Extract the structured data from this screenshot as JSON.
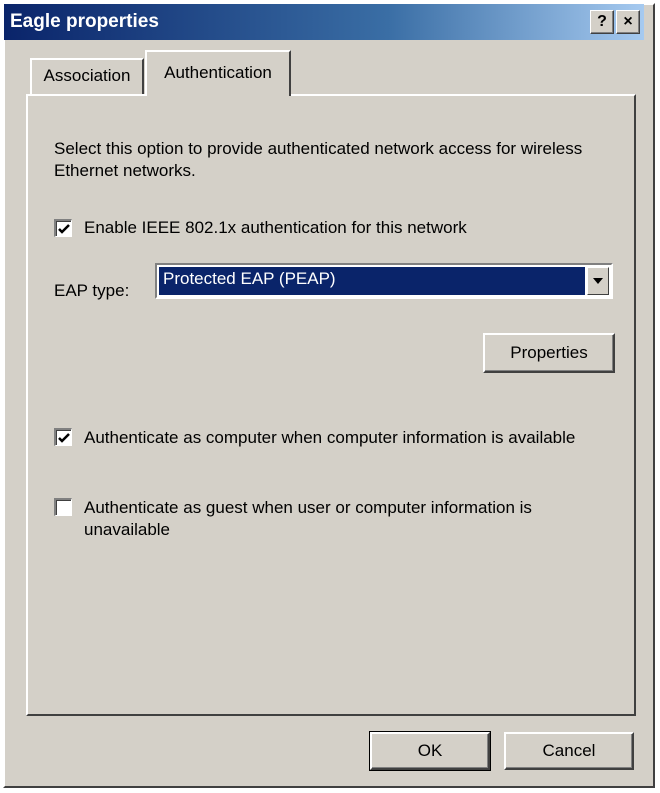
{
  "window": {
    "title": "Eagle properties",
    "help_button": "?",
    "close_button": "×"
  },
  "tabs": [
    {
      "label": "Association",
      "selected": false
    },
    {
      "label": "Authentication",
      "selected": true
    }
  ],
  "auth": {
    "description": "Select this option to provide authenticated network access for wireless Ethernet networks.",
    "enable_8021x": {
      "label": "Enable IEEE 802.1x authentication for this network",
      "checked": true
    },
    "eap_type": {
      "label": "EAP type:",
      "value": "Protected EAP (PEAP)"
    },
    "properties_button": "Properties",
    "auth_as_computer": {
      "label": "Authenticate as computer when computer information is available",
      "checked": true
    },
    "auth_as_guest": {
      "label": "Authenticate as guest when user or computer information is unavailable",
      "checked": false
    }
  },
  "footer": {
    "ok_label": "OK",
    "cancel_label": "Cancel"
  },
  "icons": [
    "help-icon",
    "close-icon",
    "checkmark-icon",
    "dropdown-arrow-icon"
  ],
  "colors": {
    "titlebar_start": "#0a246a",
    "titlebar_end": "#a6caf0",
    "face": "#d4d0c8",
    "selection": "#0a246a"
  }
}
